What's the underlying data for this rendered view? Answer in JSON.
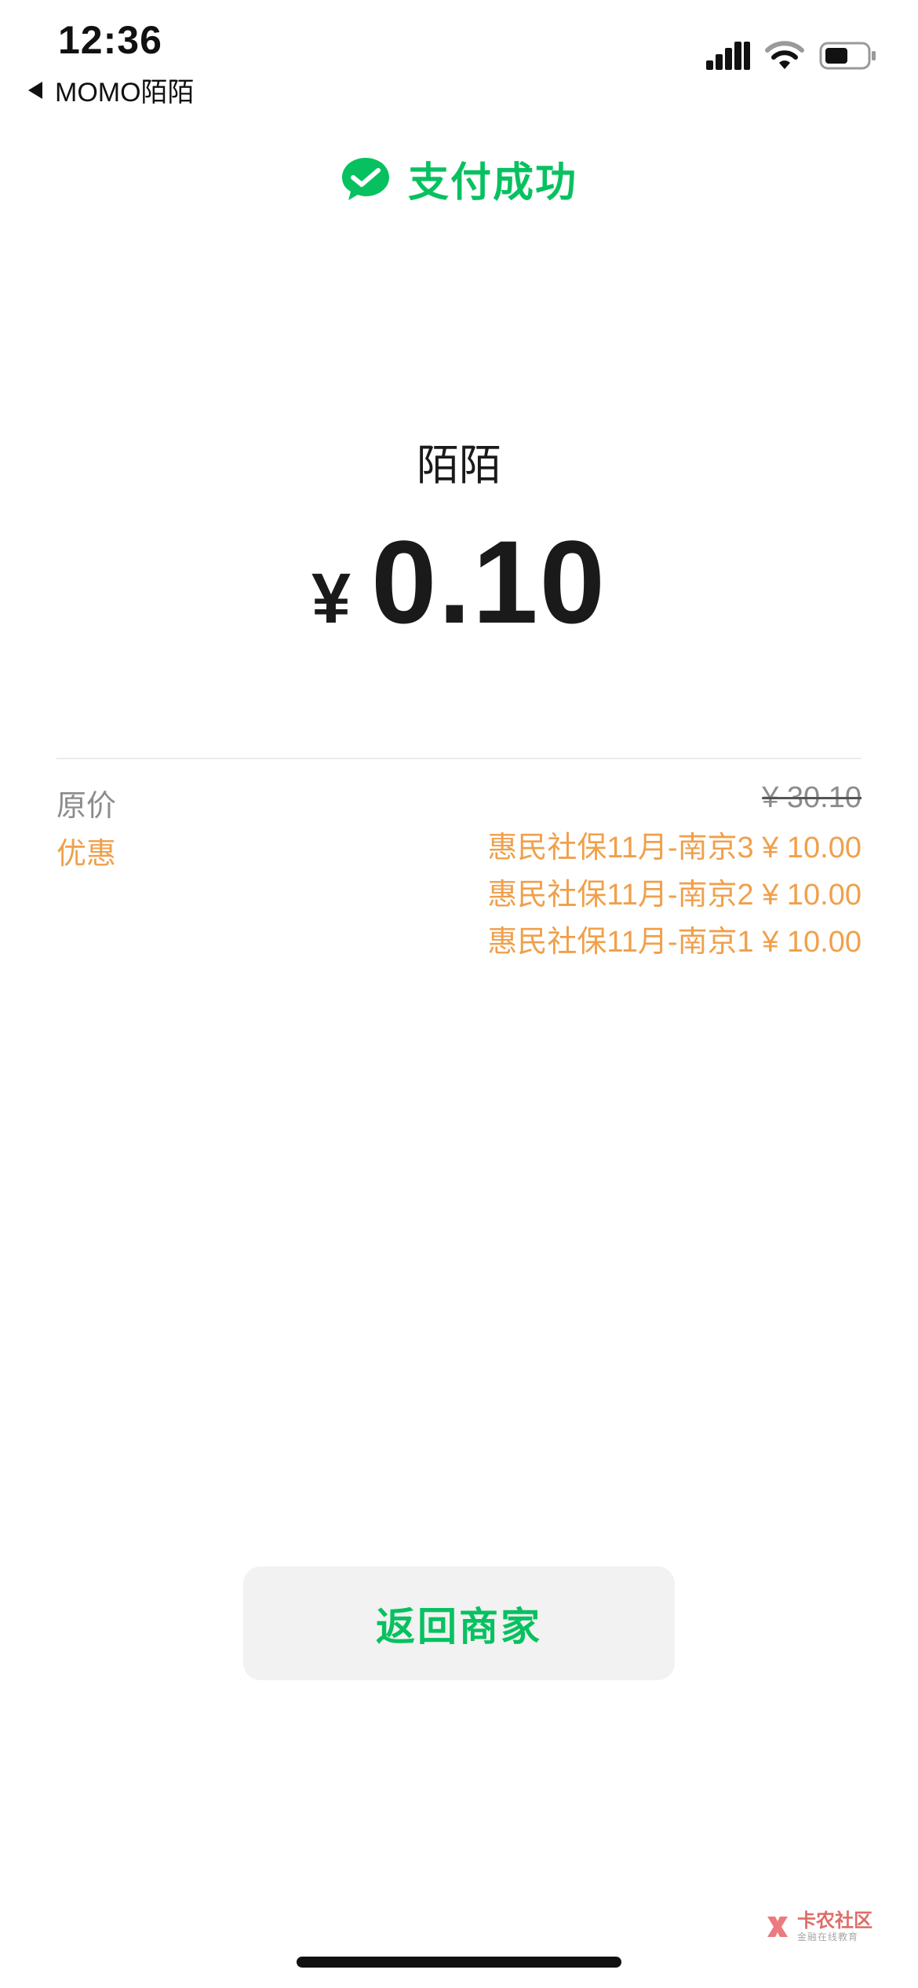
{
  "status_bar": {
    "time": "12:36",
    "back_app_label": "MOMO陌陌"
  },
  "header": {
    "title": "支付成功"
  },
  "merchant": {
    "name": "陌陌"
  },
  "payment": {
    "currency": "¥",
    "amount": "0.10"
  },
  "details": {
    "original_label": "原价",
    "original_value": "¥ 30.10",
    "discount_label": "优惠",
    "discounts": [
      "惠民社保11月-南京3 ¥ 10.00",
      "惠民社保11月-南京2 ¥ 10.00",
      "惠民社保11月-南京1 ¥ 10.00"
    ]
  },
  "actions": {
    "return_label": "返回商家"
  },
  "watermark": {
    "title": "卡农社区",
    "subtitle": "金融在线教育"
  },
  "colors": {
    "success_green": "#07c160",
    "discount_orange": "#f0a04b",
    "button_bg": "#f2f2f2"
  }
}
